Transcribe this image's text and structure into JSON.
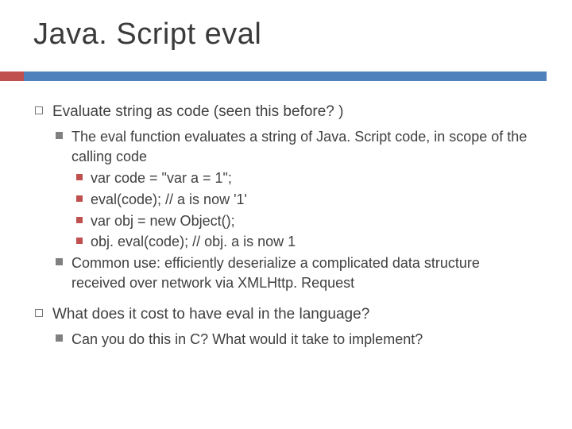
{
  "title": "Java. Script eval",
  "bullets": {
    "b1": "Evaluate string as code (seen this before? )",
    "b1_1": "The eval function evaluates a string of Java. Script code, in scope of the calling code",
    "b1_1_1": "var code = \"var a = 1\";",
    "b1_1_2": "eval(code); // a is now '1'",
    "b1_1_3": "var obj = new Object();",
    "b1_1_4": "obj. eval(code); // obj. a is now 1",
    "b1_2": "Common use: efficiently deserialize a complicated data structure received over network via XMLHttp. Request",
    "b2": "What does it cost to have eval in the language?",
    "b2_1": "Can you do this in C? What would it take to implement?"
  }
}
